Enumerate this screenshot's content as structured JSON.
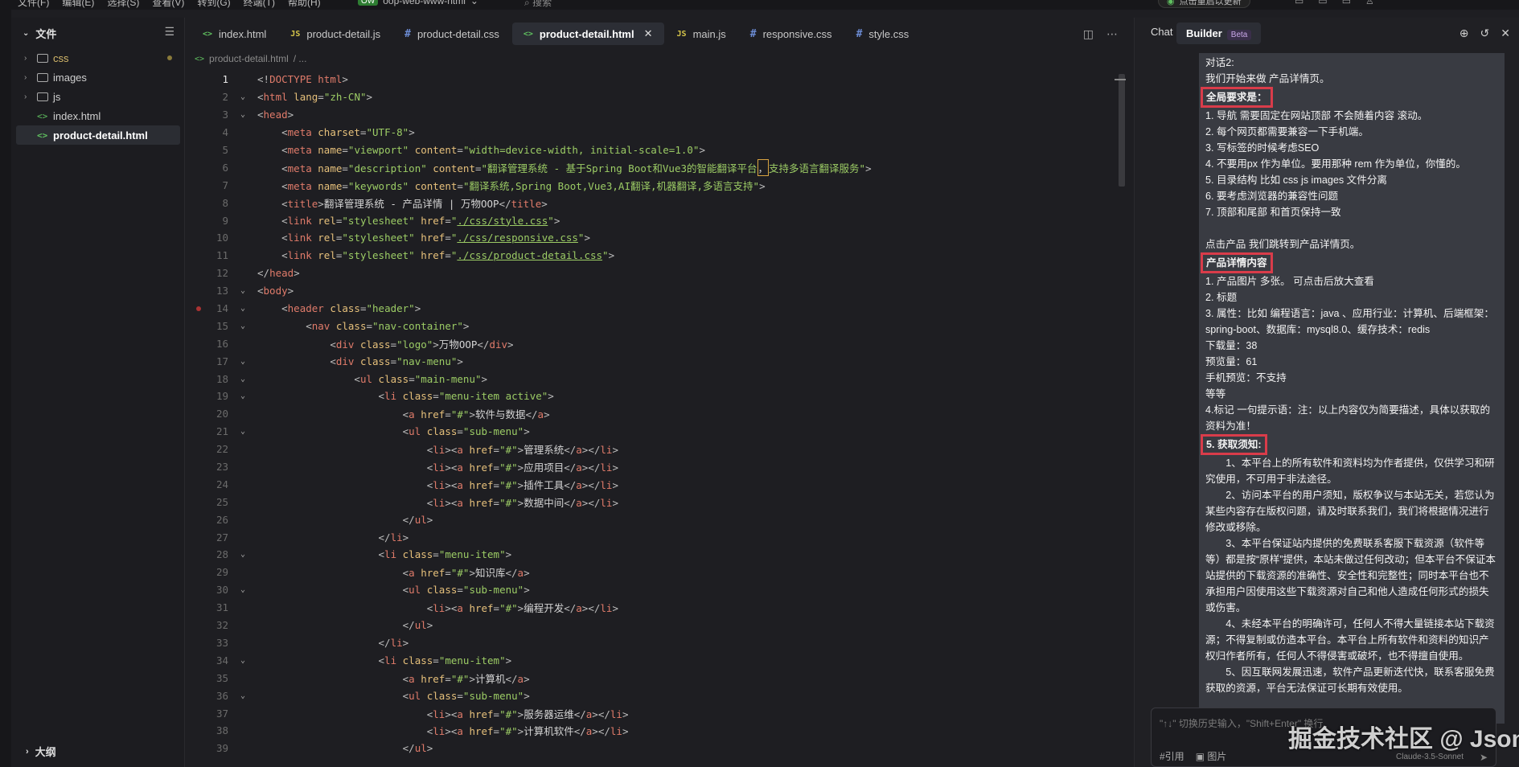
{
  "topbar": {
    "menu": [
      "文件(F)",
      "编辑(E)",
      "选择(S)",
      "查看(V)",
      "转到(G)",
      "终端(T)",
      "帮助(H)"
    ],
    "project_badge": "OW",
    "project_name": "oop-web-www-html",
    "search": "搜索",
    "update_text": "点击重启以更新"
  },
  "explorer": {
    "title": "文件",
    "items": [
      {
        "label": "css",
        "type": "folder",
        "dot": true
      },
      {
        "label": "images",
        "type": "folder"
      },
      {
        "label": "js",
        "type": "folder"
      },
      {
        "label": "index.html",
        "type": "html"
      },
      {
        "label": "product-detail.html",
        "type": "html",
        "selected": true
      }
    ],
    "outline": "大纲"
  },
  "tabs": [
    {
      "label": "index.html",
      "kind": "html"
    },
    {
      "label": "product-detail.js",
      "kind": "js"
    },
    {
      "label": "product-detail.css",
      "kind": "css"
    },
    {
      "label": "product-detail.html",
      "kind": "html",
      "active": true
    },
    {
      "label": "main.js",
      "kind": "js"
    },
    {
      "label": "responsive.css",
      "kind": "css"
    },
    {
      "label": "style.css",
      "kind": "css"
    }
  ],
  "breadcrumb": {
    "file": "product-detail.html",
    "sep": "/ ..."
  },
  "code": {
    "current_line": 1,
    "lines": [
      "<!DOCTYPE html>",
      "<html lang=\"zh-CN\">",
      "<head>",
      "    <meta charset=\"UTF-8\">",
      "    <meta name=\"viewport\" content=\"width=device-width, initial-scale=1.0\">",
      "    <meta name=\"description\" content=\"翻译管理系统 - 基于Spring Boot和Vue3的智能翻译平台，支持多语言翻译服务\">",
      "    <meta name=\"keywords\" content=\"翻译系统,Spring Boot,Vue3,AI翻译,机器翻译,多语言支持\">",
      "    <title>翻译管理系统 - 产品详情 | 万物OOP</title>",
      "    <link rel=\"stylesheet\" href=\"./css/style.css\">",
      "    <link rel=\"stylesheet\" href=\"./css/responsive.css\">",
      "    <link rel=\"stylesheet\" href=\"./css/product-detail.css\">",
      "</head>",
      "<body>",
      "    <header class=\"header\">",
      "        <nav class=\"nav-container\">",
      "            <div class=\"logo\">万物OOP</div>",
      "            <div class=\"nav-menu\">",
      "                <ul class=\"main-menu\">",
      "                    <li class=\"menu-item active\">",
      "                        <a href=\"#\">软件与数据</a>",
      "                        <ul class=\"sub-menu\">",
      "                            <li><a href=\"#\">管理系统</a></li>",
      "                            <li><a href=\"#\">应用项目</a></li>",
      "                            <li><a href=\"#\">插件工具</a></li>",
      "                            <li><a href=\"#\">数据中间</a></li>",
      "                        </ul>",
      "                    </li>",
      "                    <li class=\"menu-item\">",
      "                        <a href=\"#\">知识库</a>",
      "                        <ul class=\"sub-menu\">",
      "                            <li><a href=\"#\">编程开发</a></li>",
      "                        </ul>",
      "                    </li>",
      "                    <li class=\"menu-item\">",
      "                        <a href=\"#\">计算机</a>",
      "                        <ul class=\"sub-menu\">",
      "                            <li><a href=\"#\">服务器运维</a></li>",
      "                            <li><a href=\"#\">计算机软件</a></li>",
      "                        </ul>"
    ],
    "fold_lines": [
      2,
      3,
      13,
      14,
      15,
      17,
      18,
      19,
      21,
      28,
      30,
      34,
      36
    ],
    "breakpoint_lines": [
      14
    ]
  },
  "chat": {
    "tab_chat": "Chat",
    "tab_builder": "Builder",
    "beta": "Beta",
    "message": [
      {
        "t": "对话2:"
      },
      {
        "t": "我们开始来做 产品详情页。"
      },
      {
        "t": "全局要求是：",
        "hl": true
      },
      {
        "t": "1. 导航 需要固定在网站顶部 不会随着内容 滚动。"
      },
      {
        "t": "2. 每个网页都需要兼容一下手机端。"
      },
      {
        "t": "3. 写标签的时候考虑SEO"
      },
      {
        "t": "4. 不要用px 作为单位。要用那种 rem 作为单位，你懂的。"
      },
      {
        "t": "5. 目录结构 比如 css js images 文件分离"
      },
      {
        "t": "6. 要考虑浏览器的兼容性问题"
      },
      {
        "t": "7. 顶部和尾部 和首页保持一致"
      },
      {
        "t": ""
      },
      {
        "t": "点击产品 我们跳转到产品详情页。"
      },
      {
        "t": "产品详情内容",
        "hl": true
      },
      {
        "t": "1. 产品图片 多张。 可点击后放大查看"
      },
      {
        "t": "2. 标题"
      },
      {
        "t": "3. 属性：比如 编程语言：java 、应用行业：计算机、后端框架：spring-boot、数据库：mysql8.0、缓存技术：redis"
      },
      {
        "t": "下载量：38"
      },
      {
        "t": "预览量：61"
      },
      {
        "t": "手机预览：不支持"
      },
      {
        "t": "等等"
      },
      {
        "t": "4.标记 一句提示语：注：以上内容仅为简要描述，具体以获取的资料为准！"
      },
      {
        "t": "5. 获取须知:",
        "hl": true
      },
      {
        "t": "1、本平台上的所有软件和资料均为作者提供，仅供学习和研究使用，不可用于非法途径。",
        "ind": true
      },
      {
        "t": "2、访问本平台的用户须知，版权争议与本站无关，若您认为某些内容存在版权问题，请及时联系我们，我们将根据情况进行修改或移除。",
        "ind": true
      },
      {
        "t": "3、本平台保证站内提供的免费联系客服下载资源（软件等等）都是按“原样”提供，本站未做过任何改动；但本平台不保证本站提供的下载资源的准确性、安全性和完整性；同时本平台也不承担用户因使用这些下载资源对自己和他人造成任何形式的损失或伤害。",
        "ind": true
      },
      {
        "t": "4、未经本平台的明确许可，任何人不得大量链接本站下载资源；不得复制或仿造本平台。本平台上所有软件和资料的知识产权归作者所有，任何人不得侵害或破坏，也不得擅自使用。",
        "ind": true
      },
      {
        "t": "5、因互联网发展迅速，软件产品更新迭代快，联系客服免费获取的资源，平台无法保证可长期有效使用。",
        "ind": true
      }
    ],
    "input_placeholder": "\"↑↓\" 切换历史输入，\"Shift+Enter\" 换行",
    "ref_label": "#引用",
    "image_label": "图片",
    "model": "Claude-3.5-Sonnet"
  },
  "watermark": "掘金技术社区 @ Json_"
}
